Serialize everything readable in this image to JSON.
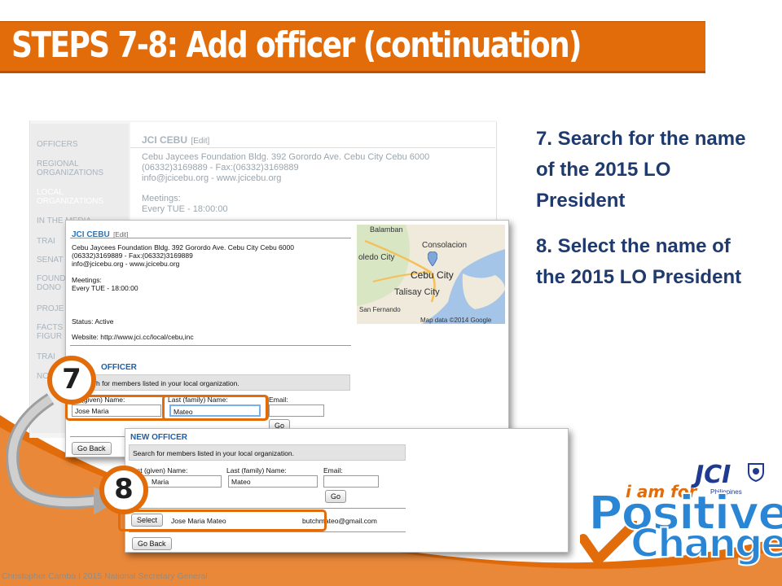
{
  "title": "STEPS 7-8: Add officer (continuation)",
  "steps": {
    "step7": "7. Search for the name of the 2015 LO President",
    "step8": "8. Select the name of the 2015 LO President"
  },
  "colors": {
    "accent": "#e36c0a",
    "navy": "#1f3a6e",
    "link_blue": "#2e74b5"
  },
  "background_shot": {
    "sidebar": [
      "OFFICERS",
      "REGIONAL ORGANIZATIONS",
      "LOCAL ORGANIZATIONS",
      "IN THE MEDIA",
      "TRAI",
      "SENAT",
      "FOUND DONO",
      "PROJE",
      "FACTS FIGUR",
      "TRAI",
      "NO"
    ],
    "org_name": "JCI CEBU",
    "edit_label": "[Edit]",
    "address": "Cebu Jaycees Foundation Bldg. 392 Gorordo Ave. Cebu City Cebu 6000",
    "phone": "(06332)3169889 - Fax:(06332)3169889",
    "email_web": "info@jcicebu.org - www.jcicebu.org",
    "meetings_label": "Meetings:",
    "meetings_value": "Every TUE - 18:00:00"
  },
  "shot1": {
    "org_name": "JCI CEBU",
    "edit_label": "[Edit]",
    "address": "Cebu Jaycees Foundation Bldg. 392 Gorordo Ave. Cebu City Cebu 6000",
    "phone": "(06332)3169889 - Fax:(06332)3169889",
    "email_web": "info@jcicebu.org - www.jcicebu.org",
    "meetings_label": "Meetings:",
    "meetings_value": "Every TUE - 18:00:00",
    "status": "Status: Active",
    "website": "Website: http://www.jci.cc/local/cebu,inc",
    "section_head": "OFFICER",
    "search_hint": "h for members listed in your local organization.",
    "first_label": "(given) Name:",
    "last_label": "Last (family) Name:",
    "email_label": "Email:",
    "first_value": "Jose Maria",
    "last_value": "Mateo",
    "go_label": "Go",
    "back_label": "Go Back",
    "map": {
      "places": [
        "Balamban",
        "Consolacion",
        "oledo City",
        "Cebu City",
        "Talisay City",
        "San Fernando"
      ],
      "credit": "Map data ©2014 Google"
    }
  },
  "shot2": {
    "section_head": "NEW OFFICER",
    "search_hint": "Search for members listed in your local organization.",
    "first_label": "st (given) Name:",
    "last_label": "Last (family) Name:",
    "email_label": "Email:",
    "first_value": "Maria",
    "last_value": "Mateo",
    "go_label": "Go",
    "select_label": "Select",
    "result_name": "Jose Maria Mateo",
    "result_email": "butchmateo@gmail.com",
    "back_label": "Go Back"
  },
  "markers": {
    "seven": "7",
    "eight": "8"
  },
  "logo": {
    "jci": "JCI",
    "phil": "Philippines",
    "iam": "i am for",
    "positive": "Positive",
    "change": "Change"
  },
  "footer": "Christopher Camba I 2015 National Secretary General"
}
